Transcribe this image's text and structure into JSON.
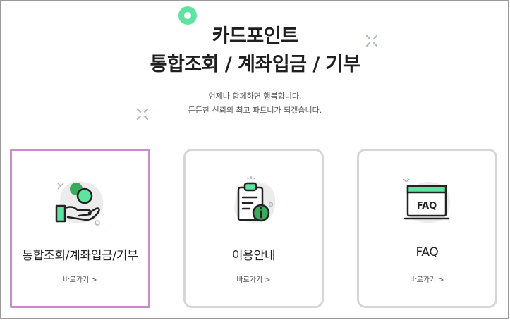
{
  "hero": {
    "title_line1": "카드포인트",
    "title_line2": "통합조회 / 계좌입금 / 기부",
    "subtitle_line1": "언제나 함께하면 행복합니다.",
    "subtitle_line2": "든든한 신뢰의 최고 파트너가 되겠습니다."
  },
  "cards": [
    {
      "title": "통합조회/계좌입금/기부",
      "link": "바로가기 >",
      "icon": "hand-coin-icon",
      "active": true
    },
    {
      "title": "이용안내",
      "link": "바로가기 >",
      "icon": "clipboard-info-icon",
      "active": false
    },
    {
      "title": "FAQ",
      "link": "바로가기 >",
      "icon": "faq-board-icon",
      "active": false
    }
  ],
  "colors": {
    "accent_green": "#5fe3a1",
    "active_border": "#c58ec8",
    "card_border": "#d6d6d6"
  }
}
